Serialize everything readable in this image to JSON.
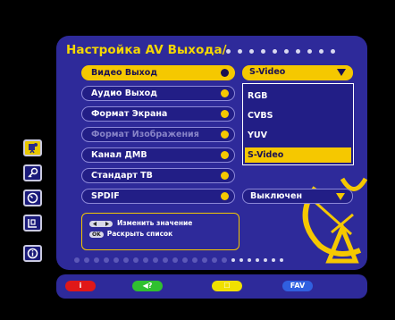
{
  "title": "Настройка AV Выхода/",
  "menu": [
    {
      "label": "Видео Выход",
      "state": "selected"
    },
    {
      "label": "Аудио Выход",
      "state": "normal"
    },
    {
      "label": "Формат Экрана",
      "state": "normal"
    },
    {
      "label": "Формат Изображения",
      "state": "disabled"
    },
    {
      "label": "Канал ДМВ",
      "state": "normal"
    },
    {
      "label": "Стандарт ТВ",
      "state": "normal"
    },
    {
      "label": "SPDIF",
      "state": "normal"
    }
  ],
  "video_output": {
    "current": "S-Video",
    "options": [
      "RGB",
      "CVBS",
      "YUV",
      "S-Video"
    ],
    "highlighted": "S-Video"
  },
  "spdif": {
    "value": "Выключен"
  },
  "help": {
    "change_value": "Изменить значение",
    "ok_label": "OK",
    "open_list": "Раскрыть список"
  },
  "sidebar_icons": [
    "av-settings-icon",
    "key-icon",
    "clock-icon",
    "info-card-icon",
    "info-icon"
  ],
  "color_buttons": [
    {
      "name": "red",
      "label": "i",
      "color": "#e01818"
    },
    {
      "name": "green",
      "label": "◀?",
      "color": "#30c030"
    },
    {
      "name": "yellow",
      "label": "☐",
      "color": "#f0e000"
    },
    {
      "name": "blue",
      "label": "FAV",
      "color": "#3060e0"
    }
  ],
  "colors": {
    "accent": "#f5c800",
    "panel": "#2e2a9a",
    "item_bg": "#221e86"
  }
}
